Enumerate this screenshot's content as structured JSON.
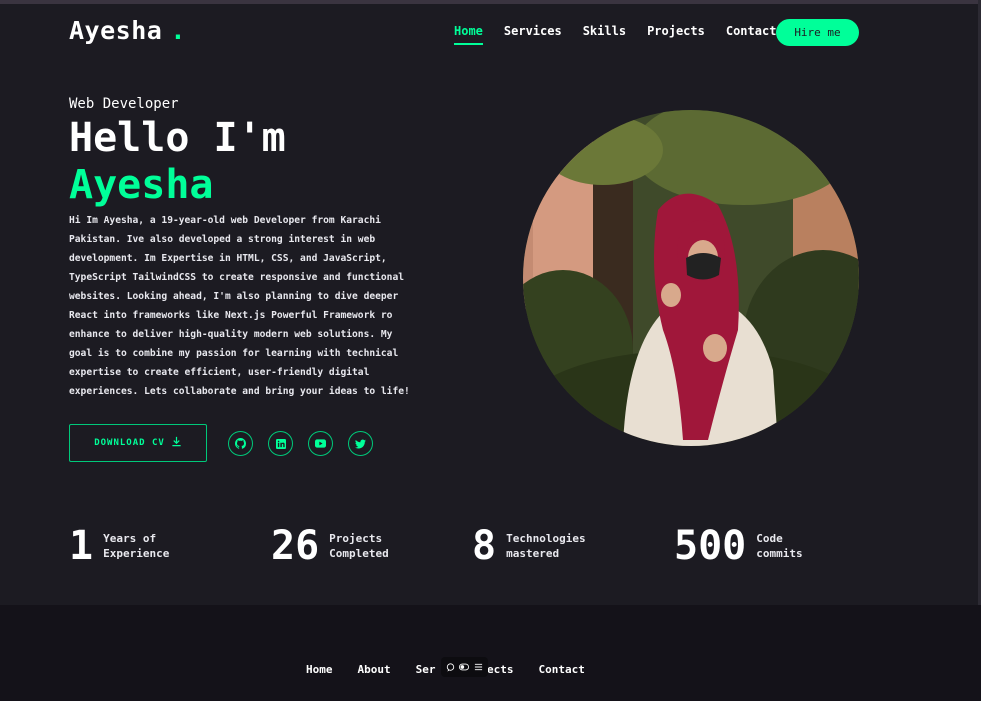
{
  "header": {
    "logo_text": "Ayesha",
    "logo_dot": ".",
    "nav": [
      {
        "label": "Home",
        "active": true
      },
      {
        "label": "Services",
        "active": false
      },
      {
        "label": "Skills",
        "active": false
      },
      {
        "label": "Projects",
        "active": false
      },
      {
        "label": "Contact",
        "active": false
      }
    ],
    "hire_label": "Hire me"
  },
  "hero": {
    "role": "Web Developer",
    "greeting": "Hello I'm",
    "name": "Ayesha",
    "bio": "Hi Im Ayesha, a 19-year-old web Developer from Karachi Pakistan. Ive also developed a strong interest in web development. Im Expertise in HTML, CSS, and JavaScript, TypeScript TailwindCSS to create responsive and functional websites. Looking ahead, I'm also planning to dive deeper React into frameworks like Next.js Powerful Framework ro enhance to deliver high-quality modern web solutions. My goal is to combine my passion for learning with technical expertise to create efficient, user-friendly digital experiences. Lets collaborate and bring your ideas to life!",
    "cv_label": "DOWNLOAD CV",
    "socials": [
      "github-icon",
      "linkedin-icon",
      "youtube-icon",
      "twitter-icon"
    ]
  },
  "stats": [
    {
      "number": "1",
      "label_line1": "Years of",
      "label_line2": "Experience"
    },
    {
      "number": "26",
      "label_line1": "Projects",
      "label_line2": "Completed"
    },
    {
      "number": "8",
      "label_line1": "Technologies",
      "label_line2": "mastered"
    },
    {
      "number": "500",
      "label_line1": "Code",
      "label_line2": "commits"
    }
  ],
  "footer": {
    "nav": [
      "Home",
      "About",
      "Ser",
      "Projects",
      "Contact"
    ]
  },
  "colors": {
    "accent": "#00ff99",
    "background": "#1c1b22",
    "footer_bg": "#141219"
  }
}
